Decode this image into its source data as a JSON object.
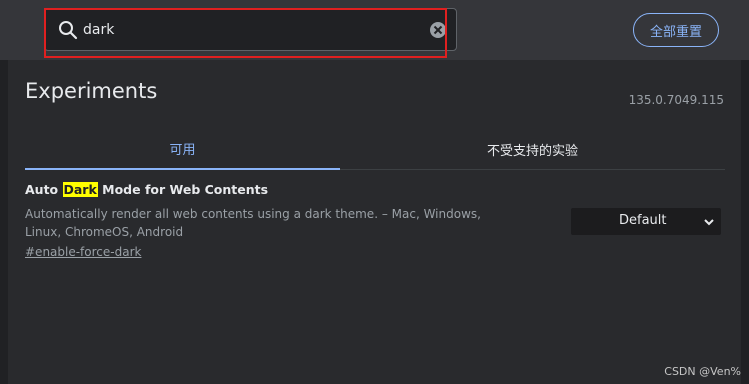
{
  "search": {
    "value": "dark",
    "icon": "search-icon",
    "clear_icon": "clear-icon"
  },
  "header": {
    "reset_all_label": "全部重置"
  },
  "page": {
    "title": "Experiments",
    "version": "135.0.7049.115"
  },
  "tabs": [
    {
      "label": "可用",
      "active": true
    },
    {
      "label": "不受支持的实验",
      "active": false
    }
  ],
  "experiment": {
    "name_prefix": "Auto ",
    "name_highlight": "Dark",
    "name_suffix": " Mode for Web Contents",
    "description": "Automatically render all web contents using a dark theme. – Mac, Windows, Linux, ChromeOS, Android",
    "link": "#enable-force-dark",
    "selected_option": "Default"
  },
  "watermark": "CSDN @Ven%",
  "colors": {
    "accent": "#8ab4f8",
    "highlight": "#ffff00",
    "frame": "#e02020"
  }
}
